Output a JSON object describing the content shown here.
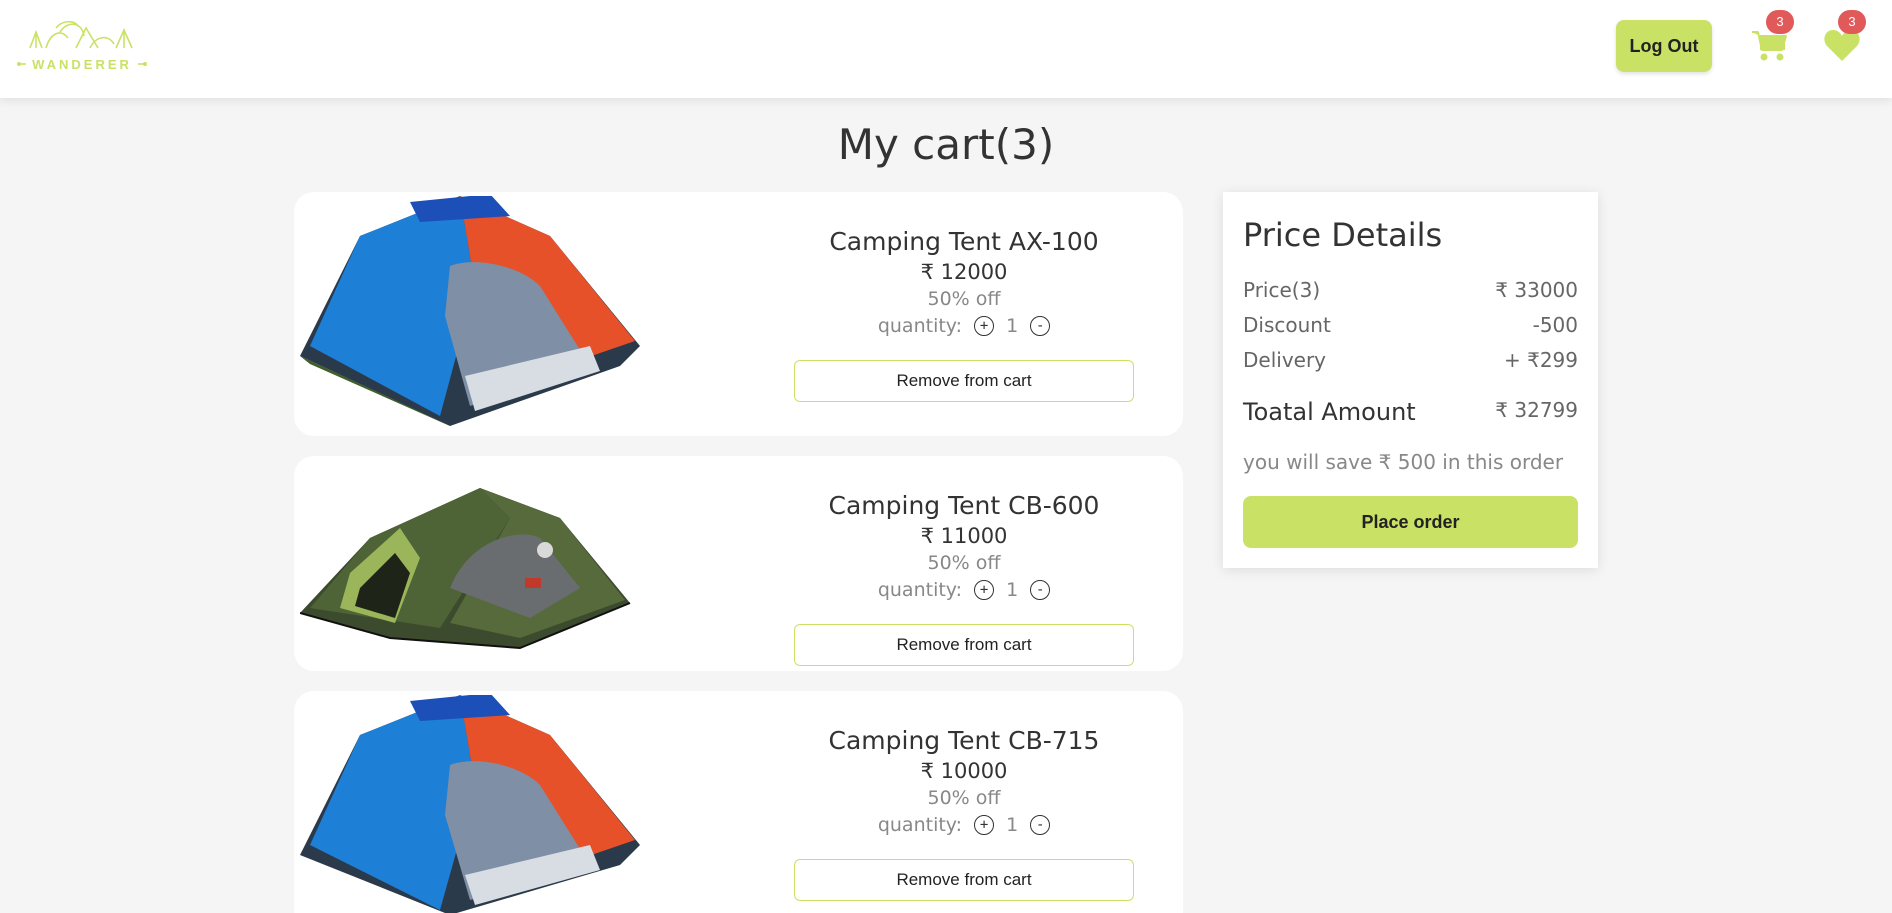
{
  "brand": {
    "name": "WANDERER",
    "accent": "#c9e265"
  },
  "header": {
    "logout_label": "Log Out",
    "cart_count": "3",
    "wishlist_count": "3",
    "cart_icon": "shopping-cart-icon",
    "wishlist_icon": "heart-icon"
  },
  "page_title": "My cart(3)",
  "cart_items": [
    {
      "name": "Camping Tent AX-100",
      "price": "₹ 12000",
      "discount": "50% off",
      "quantity_label": "quantity:",
      "quantity": "1",
      "remove_label": "Remove from cart",
      "image": "blue-orange-dome-tent"
    },
    {
      "name": "Camping Tent CB-600",
      "price": "₹ 11000",
      "discount": "50% off",
      "quantity_label": "quantity:",
      "quantity": "1",
      "remove_label": "Remove from cart",
      "image": "green-dome-tent"
    },
    {
      "name": "Camping Tent CB-715",
      "price": "₹ 10000",
      "discount": "50% off",
      "quantity_label": "quantity:",
      "quantity": "1",
      "remove_label": "Remove from cart",
      "image": "blue-orange-dome-tent"
    }
  ],
  "qty_controls": {
    "increment": "+",
    "decrement": "-"
  },
  "price_details": {
    "title": "Price Details",
    "rows": [
      {
        "label": "Price(3)",
        "value": "₹ 33000"
      },
      {
        "label": "Discount",
        "value": "-500"
      },
      {
        "label": "Delivery",
        "value": "+ ₹299"
      }
    ],
    "total_label": "Toatal Amount",
    "total_value": "₹ 32799",
    "savings_text": "you will save ₹ 500 in this order",
    "place_order_label": "Place order"
  }
}
